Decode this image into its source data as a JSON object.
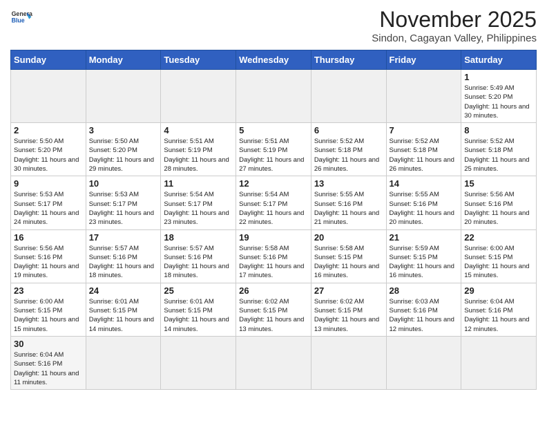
{
  "header": {
    "logo_general": "General",
    "logo_blue": "Blue",
    "month_title": "November 2025",
    "location": "Sindon, Cagayan Valley, Philippines"
  },
  "days_of_week": [
    "Sunday",
    "Monday",
    "Tuesday",
    "Wednesday",
    "Thursday",
    "Friday",
    "Saturday"
  ],
  "weeks": [
    [
      {
        "date": "",
        "content": ""
      },
      {
        "date": "",
        "content": ""
      },
      {
        "date": "",
        "content": ""
      },
      {
        "date": "",
        "content": ""
      },
      {
        "date": "",
        "content": ""
      },
      {
        "date": "",
        "content": ""
      },
      {
        "date": "1",
        "content": "Sunrise: 5:49 AM\nSunset: 5:20 PM\nDaylight: 11 hours and 30 minutes."
      }
    ],
    [
      {
        "date": "2",
        "content": "Sunrise: 5:50 AM\nSunset: 5:20 PM\nDaylight: 11 hours and 30 minutes."
      },
      {
        "date": "3",
        "content": "Sunrise: 5:50 AM\nSunset: 5:20 PM\nDaylight: 11 hours and 29 minutes."
      },
      {
        "date": "4",
        "content": "Sunrise: 5:51 AM\nSunset: 5:19 PM\nDaylight: 11 hours and 28 minutes."
      },
      {
        "date": "5",
        "content": "Sunrise: 5:51 AM\nSunset: 5:19 PM\nDaylight: 11 hours and 27 minutes."
      },
      {
        "date": "6",
        "content": "Sunrise: 5:52 AM\nSunset: 5:18 PM\nDaylight: 11 hours and 26 minutes."
      },
      {
        "date": "7",
        "content": "Sunrise: 5:52 AM\nSunset: 5:18 PM\nDaylight: 11 hours and 26 minutes."
      },
      {
        "date": "8",
        "content": "Sunrise: 5:52 AM\nSunset: 5:18 PM\nDaylight: 11 hours and 25 minutes."
      }
    ],
    [
      {
        "date": "9",
        "content": "Sunrise: 5:53 AM\nSunset: 5:17 PM\nDaylight: 11 hours and 24 minutes."
      },
      {
        "date": "10",
        "content": "Sunrise: 5:53 AM\nSunset: 5:17 PM\nDaylight: 11 hours and 23 minutes."
      },
      {
        "date": "11",
        "content": "Sunrise: 5:54 AM\nSunset: 5:17 PM\nDaylight: 11 hours and 23 minutes."
      },
      {
        "date": "12",
        "content": "Sunrise: 5:54 AM\nSunset: 5:17 PM\nDaylight: 11 hours and 22 minutes."
      },
      {
        "date": "13",
        "content": "Sunrise: 5:55 AM\nSunset: 5:16 PM\nDaylight: 11 hours and 21 minutes."
      },
      {
        "date": "14",
        "content": "Sunrise: 5:55 AM\nSunset: 5:16 PM\nDaylight: 11 hours and 20 minutes."
      },
      {
        "date": "15",
        "content": "Sunrise: 5:56 AM\nSunset: 5:16 PM\nDaylight: 11 hours and 20 minutes."
      }
    ],
    [
      {
        "date": "16",
        "content": "Sunrise: 5:56 AM\nSunset: 5:16 PM\nDaylight: 11 hours and 19 minutes."
      },
      {
        "date": "17",
        "content": "Sunrise: 5:57 AM\nSunset: 5:16 PM\nDaylight: 11 hours and 18 minutes."
      },
      {
        "date": "18",
        "content": "Sunrise: 5:57 AM\nSunset: 5:16 PM\nDaylight: 11 hours and 18 minutes."
      },
      {
        "date": "19",
        "content": "Sunrise: 5:58 AM\nSunset: 5:16 PM\nDaylight: 11 hours and 17 minutes."
      },
      {
        "date": "20",
        "content": "Sunrise: 5:58 AM\nSunset: 5:15 PM\nDaylight: 11 hours and 16 minutes."
      },
      {
        "date": "21",
        "content": "Sunrise: 5:59 AM\nSunset: 5:15 PM\nDaylight: 11 hours and 16 minutes."
      },
      {
        "date": "22",
        "content": "Sunrise: 6:00 AM\nSunset: 5:15 PM\nDaylight: 11 hours and 15 minutes."
      }
    ],
    [
      {
        "date": "23",
        "content": "Sunrise: 6:00 AM\nSunset: 5:15 PM\nDaylight: 11 hours and 15 minutes."
      },
      {
        "date": "24",
        "content": "Sunrise: 6:01 AM\nSunset: 5:15 PM\nDaylight: 11 hours and 14 minutes."
      },
      {
        "date": "25",
        "content": "Sunrise: 6:01 AM\nSunset: 5:15 PM\nDaylight: 11 hours and 14 minutes."
      },
      {
        "date": "26",
        "content": "Sunrise: 6:02 AM\nSunset: 5:15 PM\nDaylight: 11 hours and 13 minutes."
      },
      {
        "date": "27",
        "content": "Sunrise: 6:02 AM\nSunset: 5:15 PM\nDaylight: 11 hours and 13 minutes."
      },
      {
        "date": "28",
        "content": "Sunrise: 6:03 AM\nSunset: 5:16 PM\nDaylight: 11 hours and 12 minutes."
      },
      {
        "date": "29",
        "content": "Sunrise: 6:04 AM\nSunset: 5:16 PM\nDaylight: 11 hours and 12 minutes."
      }
    ],
    [
      {
        "date": "30",
        "content": "Sunrise: 6:04 AM\nSunset: 5:16 PM\nDaylight: 11 hours and 11 minutes."
      },
      {
        "date": "",
        "content": ""
      },
      {
        "date": "",
        "content": ""
      },
      {
        "date": "",
        "content": ""
      },
      {
        "date": "",
        "content": ""
      },
      {
        "date": "",
        "content": ""
      },
      {
        "date": "",
        "content": ""
      }
    ]
  ]
}
